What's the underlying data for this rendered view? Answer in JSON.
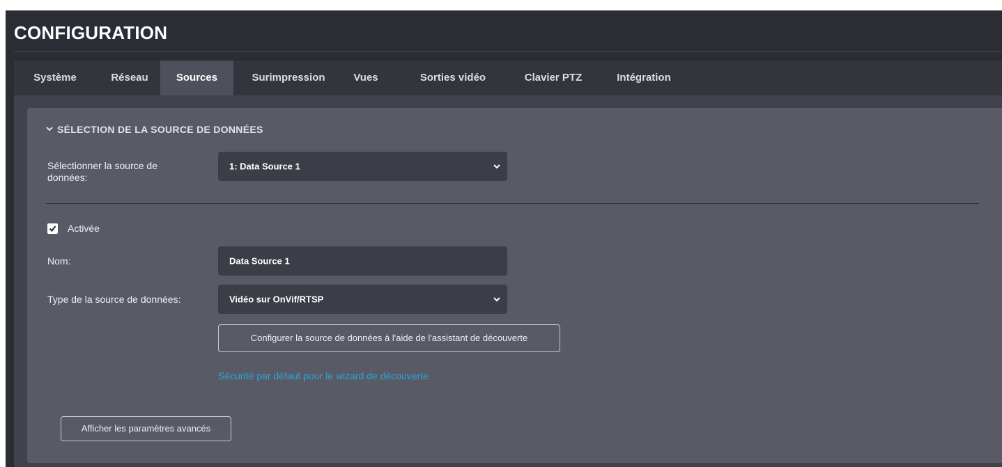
{
  "header": {
    "title": "CONFIGURATION"
  },
  "tabs": [
    {
      "label": "Système"
    },
    {
      "label": "Réseau"
    },
    {
      "label": "Sources"
    },
    {
      "label": "Surimpression"
    },
    {
      "label": "Vues"
    },
    {
      "label": "Sorties vidéo"
    },
    {
      "label": "Clavier PTZ"
    },
    {
      "label": "Intégration"
    }
  ],
  "active_tab": "Sources",
  "section": {
    "title": "SÉLECTION DE LA SOURCE DE DONNÉES",
    "select_source": {
      "label_line1": "Sélectionner la source de",
      "label_line2": "données:",
      "value": "1: Data Source 1"
    },
    "enabled": {
      "label": "Activée",
      "checked": true
    },
    "name": {
      "label": "Nom:",
      "value": "Data Source 1"
    },
    "source_type": {
      "label": "Type de la source de données:",
      "value": "Vidéo sur OnVif/RTSP"
    },
    "discovery_button": "Configurer la source de données à l'aide de l'assistant de découverte",
    "security_link": "Sécurité par défaut pour le wizard de découverte",
    "advanced_button": "Afficher les paramètres avancés"
  },
  "colors": {
    "background": "#2b2d34",
    "panel": "#585b66",
    "field": "#3b3e46",
    "link": "#2aa6d8",
    "active_tab": "#4e515b"
  },
  "icons": {
    "section_toggle": "chevron-down-icon",
    "select_caret": "chevron-down-icon",
    "checkbox": "checkmark-icon"
  }
}
